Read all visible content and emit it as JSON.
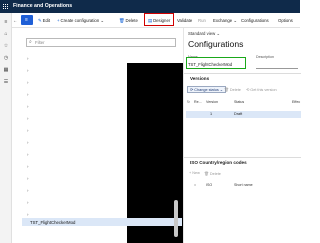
{
  "topbar": {
    "title": "Finance and Operations"
  },
  "actionbar": {
    "edit": "Edit",
    "create": "Create configuration",
    "delete": "Delete",
    "designer": "Designer",
    "validate": "Validate",
    "run": "Run",
    "exchange": "Exchange",
    "configurations": "Configurations",
    "options": "Options"
  },
  "filter": {
    "placeholder": "Filter"
  },
  "tree": {
    "selected_label": "TST_FlightCheckerMod"
  },
  "right": {
    "standard_view": "Standard view",
    "title": "Configurations",
    "name_label": "Name",
    "description_label": "Description",
    "name_value": "TST_FlightCheckerMod",
    "versions_title": "Versions",
    "change_status": "Change status",
    "delete": "Delete",
    "get_this_version": "Get this version",
    "col_re": "Re...",
    "col_version": "Version",
    "col_status": "Status",
    "col_effective": "Effec",
    "row_version": "1",
    "row_status": "Draft",
    "iso_title": "ISO Country/region codes",
    "new": "New",
    "delete2": "Delete",
    "col_iso": "ISO",
    "col_short": "Short name"
  },
  "colors": {
    "brand": "#0f2a4a",
    "accent": "#1f5fd6",
    "highlight_red": "#d10000",
    "highlight_green": "#1aa81a",
    "selection": "#dbe7f7"
  }
}
